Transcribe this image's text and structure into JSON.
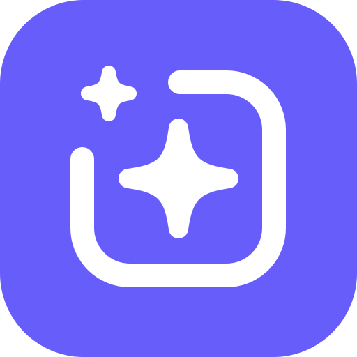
{
  "icon": {
    "name": "ai-sparkle-app-icon",
    "glyph": "sparkle-frame-icon",
    "background_color": "#675DFA",
    "foreground_color": "#FFFFFF"
  }
}
